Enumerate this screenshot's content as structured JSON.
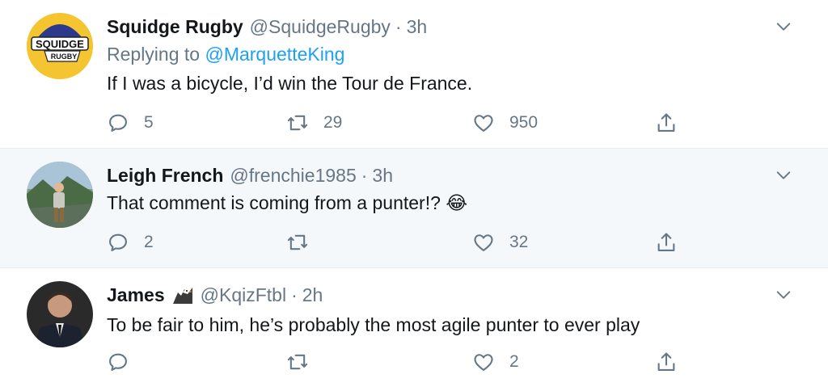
{
  "tweets": [
    {
      "name": "Squidge Rugby",
      "handle": "@SquidgeRugby",
      "time": "3h",
      "replying_prefix": "Replying to",
      "replying_to": "@MarquetteKing",
      "text": "If I was a bicycle, I’d win the Tour de France.",
      "avatar_text_top": "SQUIDGE",
      "avatar_text_bottom": "RUGBY",
      "reply_count": "5",
      "retweet_count": "29",
      "like_count": "950"
    },
    {
      "name": "Leigh French",
      "handle": "@frenchie1985",
      "time": "3h",
      "text": "That comment is coming from a punter!?",
      "text_emoji": "😂",
      "reply_count": "2",
      "retweet_count": "",
      "like_count": "32"
    },
    {
      "name": "James",
      "name_emoji": "eagle-icon",
      "handle": "@KqizFtbl",
      "time": "2h",
      "text": "To be fair to him, he’s probably the most agile punter to ever play",
      "reply_count": "",
      "retweet_count": "",
      "like_count": "2"
    }
  ],
  "separator": "·",
  "colors": {
    "text": "#14171a",
    "secondary": "#657786",
    "link": "#1da1f2",
    "highlight_bg": "#f5f8fa",
    "thread_line": "#ccd6dd"
  }
}
